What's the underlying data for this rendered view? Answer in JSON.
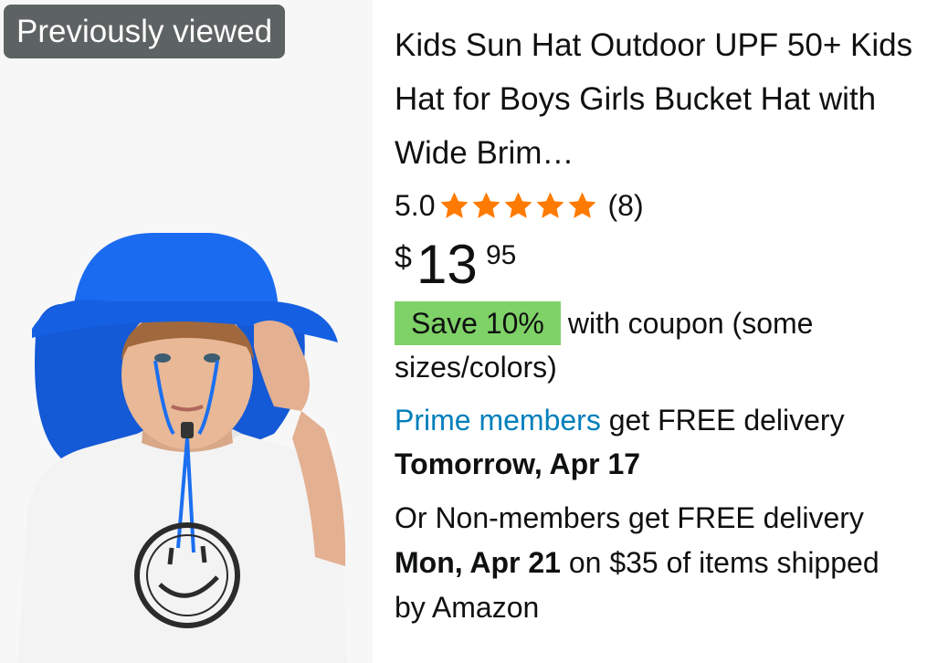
{
  "badge": {
    "label": "Previously viewed"
  },
  "product": {
    "title": "Kids Sun Hat Outdoor UPF 50+ Kids Hat for Boys Girls Bucket Hat with Wide Brim…",
    "rating": "5.0",
    "stars": 5,
    "review_count": "(8)",
    "price": {
      "symbol": "$",
      "whole": "13",
      "fraction": "95"
    },
    "coupon": {
      "badge": "Save 10%",
      "text": "with coupon (some sizes/colors)"
    },
    "delivery": {
      "prime_link": "Prime members",
      "prime_text": " get FREE delivery",
      "prime_date": "Tomorrow, Apr 17",
      "nonmember_prefix": "Or Non-members get FREE delivery ",
      "nonmember_date": "Mon, Apr 21",
      "nonmember_suffix": " on $35 of items shipped by Amazon"
    }
  },
  "colors": {
    "star": "#ff7b00",
    "prime_link": "#007fbb",
    "coupon_bg": "#7fd267",
    "hat": "#1565e0",
    "badge_bg": "#5d6263"
  }
}
